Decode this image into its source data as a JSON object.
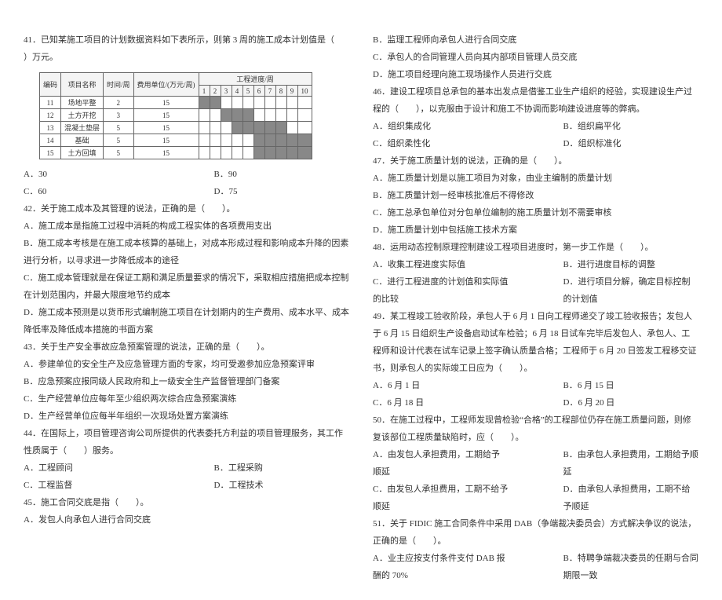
{
  "left": {
    "q41_stem": "41．已知某施工项目的计划数据资料如下表所示，则第 3 周的施工成本计划值是（　　）万元。",
    "table": {
      "head1": [
        "编码",
        "项目名称",
        "时间/周",
        "费用单位/(万元/周)",
        "工程进度/周"
      ],
      "head2": [
        "1",
        "2",
        "3",
        "4",
        "5",
        "6",
        "7",
        "8",
        "9",
        "10"
      ],
      "rows": [
        {
          "code": "11",
          "name": "场地平整",
          "w": "2",
          "cost": "15",
          "bar": [
            1,
            2
          ]
        },
        {
          "code": "12",
          "name": "土方开挖",
          "w": "3",
          "cost": "15",
          "bar": [
            3,
            4,
            5
          ]
        },
        {
          "code": "13",
          "name": "混凝土垫层",
          "w": "5",
          "cost": "15",
          "bar": [
            4,
            5,
            6,
            7,
            8
          ]
        },
        {
          "code": "14",
          "name": "基础",
          "w": "5",
          "cost": "15",
          "bar": [
            6,
            7,
            8,
            9,
            10
          ]
        },
        {
          "code": "15",
          "name": "土方回填",
          "w": "5",
          "cost": "15",
          "bar": [
            6,
            7,
            8,
            9,
            10
          ]
        }
      ]
    },
    "q41_a": "A．30",
    "q41_b": "B．90",
    "q41_c": "C．60",
    "q41_d": "D．75",
    "q42_stem": "42．关于施工成本及其管理的说法，正确的是（　　）。",
    "q42_a": "A．施工成本是指施工过程中消耗的构成工程实体的各项费用支出",
    "q42_b": "B．施工成本考核是在施工成本核算的基础上，对成本形成过程和影响成本升降的因素进行分析，以寻求进一步降低成本的途径",
    "q42_c": "C．施工成本管理就是在保证工期和满足质量要求的情况下，采取相应措施把成本控制在计划范围内，并最大限度地节约成本",
    "q42_d": "D．施工成本预测是以货币形式编制施工项目在计划期内的生产费用、成本水平、成本降低率及降低成本措施的书面方案",
    "q43_stem": "43．关于生产安全事故应急预案管理的说法，正确的是（　　）。",
    "q43_a": "A．参建单位的安全生产及应急管理方面的专家，均可受邀参加应急预案评审",
    "q43_b": "B．应急预案应报同级人民政府和上一级安全生产监督管理部门备案",
    "q43_c": "C．生产经营单位应每年至少组织两次综合应急预案演练",
    "q43_d": "D．生产经营单位应每半年组织一次现场处置方案演练",
    "q44_stem": "44．在国际上，项目管理咨询公司所提供的代表委托方利益的项目管理服务，其工作性质属于（　　）服务。",
    "q44_a": "A．工程顾问",
    "q44_b": "B．工程采购",
    "q44_c": "C．工程监督",
    "q44_d": "D．工程技术",
    "q45_stem": "45．施工合同交底是指（　　）。",
    "q45_a": "A．发包人向承包人进行合同交底"
  },
  "right": {
    "q45_b": "B．监理工程师向承包人进行合同交底",
    "q45_c": "C．承包人的合同管理人员向其内部项目管理人员交底",
    "q45_d": "D．施工项目经理向施工现场操作人员进行交底",
    "q46_stem": "46．建设工程项目总承包的基本出发点是借鉴工业生产组织的经验，实现建设生产过程的（　　），以克服由于设计和施工不协调而影响建设进度等的弊病。",
    "q46_a": "A．组织集成化",
    "q46_b": "B．组织扁平化",
    "q46_c": "C．组织柔性化",
    "q46_d": "D．组织标准化",
    "q47_stem": "47．关于施工质量计划的说法，正确的是（　　）。",
    "q47_a": "A．施工质量计划是以施工项目为对象，由业主编制的质量计划",
    "q47_b": "B．施工质量计划一经审核批准后不得修改",
    "q47_c": "C．施工总承包单位对分包单位编制的施工质量计划不需要审核",
    "q47_d": "D．施工质量计划中包括施工技术方案",
    "q48_stem": "48．运用动态控制原理控制建设工程项目进度时，第一步工作是（　　）。",
    "q48_a": "A．收集工程进度实际值",
    "q48_b": "B．进行进度目标的调整",
    "q48_c": "C．进行工程进度的计划值和实际值的比较",
    "q48_d": "D．进行项目分解，确定目标控制的计划值",
    "q49_stem": "49．某工程竣工验收阶段，承包人于 6 月 1 日向工程师递交了竣工验收报告；发包人于 6 月 15 日组织生产设备启动试车检验；6 月 18 日试车完毕后发包人、承包人、工程师和设计代表在试车记录上签字确认质量合格；工程师于 6 月 20 日签发工程移交证书，则承包人的实际竣工日应为（　　）。",
    "q49_a": "A．6 月 1 日",
    "q49_b": "B．6 月 15 日",
    "q49_c": "C．6 月 18 日",
    "q49_d": "D．6 月 20 日",
    "q50_stem": "50．在施工过程中，工程师发现曾检验“合格”的工程部位仍存在施工质量问题，则修复该部位工程质量缺陷时，应（　　）。",
    "q50_a": "A．由发包人承担费用，工期给予顺延",
    "q50_b": "B．由承包人承担费用，工期给予顺延",
    "q50_c": "C．由发包人承担费用，工期不给予顺延",
    "q50_d": "D．由承包人承担费用，工期不给予顺延",
    "q51_stem": "51．关于 FIDIC 施工合同条件中采用 DAB（争端裁决委员会）方式解决争议的说法，正确的是（　　）。",
    "q51_a": "A．业主应按支付条件支付 DAB 报酬的 70%",
    "q51_b": "B．特聘争端裁决委员的任期与合同期限一致"
  }
}
